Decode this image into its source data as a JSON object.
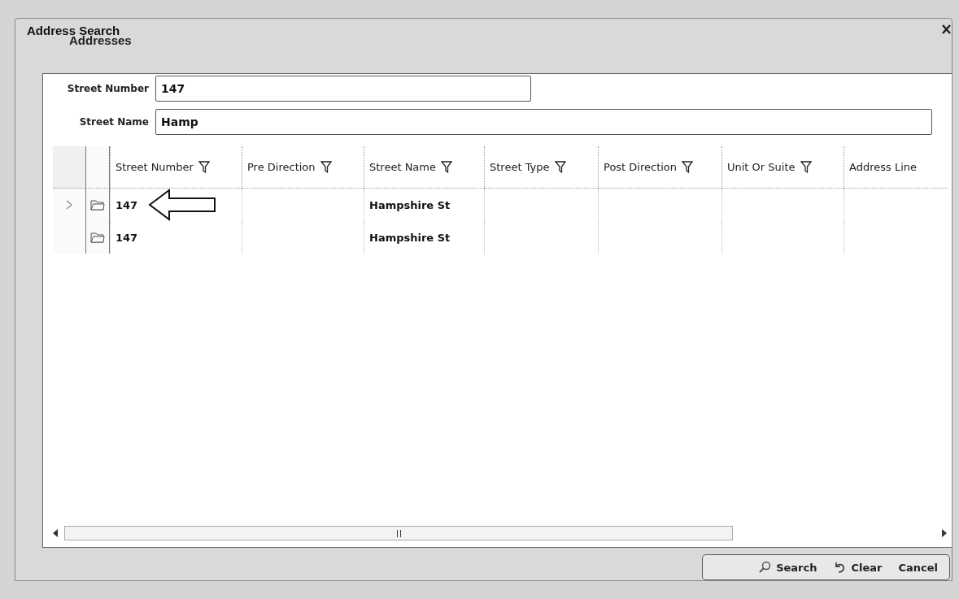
{
  "window": {
    "title": "Address Search"
  },
  "group": {
    "title": "Addresses"
  },
  "fields": [
    {
      "label": "Street Number",
      "value": "147",
      "kind": "short"
    },
    {
      "label": "Street Name",
      "value": "Hamp",
      "kind": "wide"
    }
  ],
  "table": {
    "columns": [
      "Street Number",
      "Pre Direction",
      "Street Name",
      "Street Type",
      "Post Direction",
      "Unit Or Suite",
      "Address Line"
    ],
    "rows": [
      {
        "selected": true,
        "cells": [
          "147",
          "",
          "Hampshire St",
          "",
          "",
          "",
          ""
        ]
      },
      {
        "selected": false,
        "cells": [
          "147",
          "",
          "Hampshire St",
          "",
          "",
          "",
          ""
        ]
      }
    ]
  },
  "buttons": [
    "Search",
    "Clear",
    "Cancel"
  ]
}
